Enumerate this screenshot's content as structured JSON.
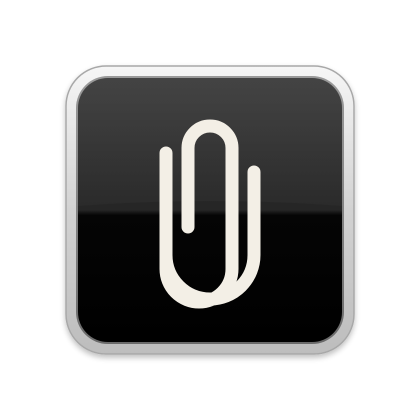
{
  "app_icon": {
    "icon": "paperclip-icon",
    "colors": {
      "background": "#ffffff",
      "bezel_light": "#f4f4f4",
      "bezel_dark": "#b9b9b9",
      "tile_top": "#2e2e2e",
      "tile_bottom": "#000000",
      "glyph": "#f3efe6"
    }
  }
}
